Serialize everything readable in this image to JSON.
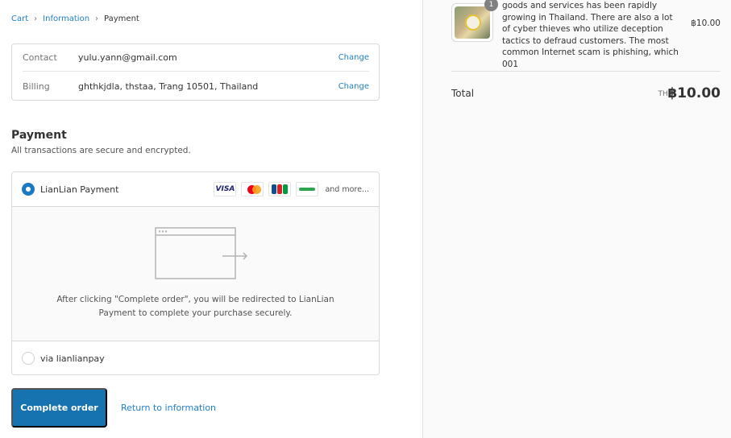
{
  "breadcrumb": {
    "cart": "Cart",
    "information": "Information",
    "current": "Payment",
    "separator": "›"
  },
  "info": {
    "contact_label": "Contact",
    "contact_value": "yulu.yann@gmail.com",
    "billing_label": "Billing",
    "billing_value": "ghthkjdla, thstaa, Trang 10501, Thailand",
    "change_label": "Change"
  },
  "payment": {
    "title": "Payment",
    "subtitle": "All transactions are secure and encrypted.",
    "option1_label": "LianLian Payment",
    "more_label": "and more...",
    "card_visa": "VISA",
    "redirect_text": "After clicking \"Complete order\", you will be redirected to LianLian Payment to complete your purchase securely.",
    "option2_label": "via lianlianpay"
  },
  "actions": {
    "complete_label": "Complete order",
    "return_label": "Return to information"
  },
  "summary": {
    "quantity": "1",
    "product_description": "goods and services has been rapidly growing in Thailand. There are also a lot of cyber thieves who utilize deception tactics to defraud customers. The most common Internet scam is phishing, which 001",
    "product_price": "฿10.00",
    "total_label": "Total",
    "total_currency": "THB",
    "total_value": "฿10.00"
  },
  "colors": {
    "accent": "#1773b0",
    "link": "#1f7fc4",
    "sidebar_bg": "#fafafa"
  }
}
